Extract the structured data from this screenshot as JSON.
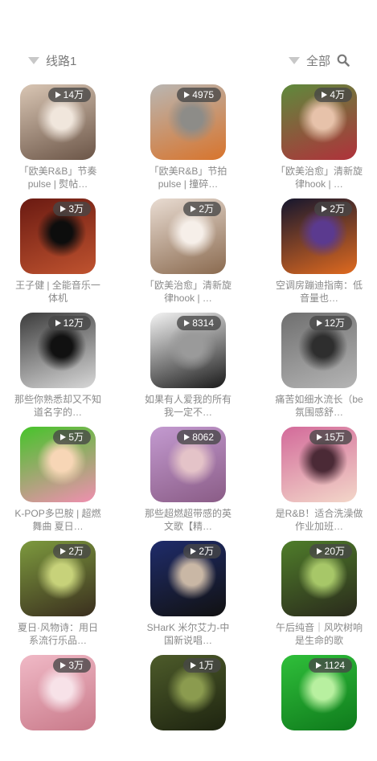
{
  "header": {
    "route_label": "线路1",
    "filter_label": "全部"
  },
  "playlists": [
    {
      "count": "14万",
      "title": "「欧美R&B」节奏pulse | 熨帖…",
      "thumb": "portrait-mirror",
      "colors": [
        "#d9c6b4",
        "#6b5547",
        "#f0e6dc"
      ]
    },
    {
      "count": "4975",
      "title": "「欧美R&B」节拍pulse | 撞碎…",
      "thumb": "orange-hair",
      "colors": [
        "#b9b6b2",
        "#d8742c",
        "#8d8c88"
      ]
    },
    {
      "count": "4万",
      "title": "「欧美治愈」清新旋律hook | …",
      "thumb": "red-jacket",
      "colors": [
        "#5e8a3c",
        "#b0313b",
        "#e7c2aa"
      ]
    },
    {
      "count": "3万",
      "title": "王子健 | 全能音乐一体机",
      "thumb": "red-planet",
      "colors": [
        "#6a1a12",
        "#c0532f",
        "#0d0d0d"
      ]
    },
    {
      "count": "2万",
      "title": "「欧美治愈」清新旋律hook | …",
      "thumb": "braids",
      "colors": [
        "#e9dcd2",
        "#8a6a4f",
        "#f6efe9"
      ]
    },
    {
      "count": "2万",
      "title": "空调房蹦迪指南：低音量也…",
      "thumb": "neon-boy",
      "colors": [
        "#15162e",
        "#e06a1f",
        "#5b3a8f"
      ]
    },
    {
      "count": "12万",
      "title": "那些你熟悉却又不知道名字的…",
      "thumb": "bw-book",
      "colors": [
        "#3c3c3c",
        "#d8d8d8",
        "#111111"
      ]
    },
    {
      "count": "8314",
      "title": "如果有人爱我的所有 我一定不…",
      "thumb": "manga",
      "colors": [
        "#f4f4f4",
        "#1a1a1a",
        "#9a9a9a"
      ]
    },
    {
      "count": "12万",
      "title": "痛苦如细水流长（be氛围感舒…",
      "thumb": "bw-pattern",
      "colors": [
        "#6f6f6f",
        "#b5b5b5",
        "#2e2e2e"
      ]
    },
    {
      "count": "5万",
      "title": "K-POP多巴胺 | 超燃舞曲 夏日…",
      "thumb": "anime-girl",
      "colors": [
        "#46c42a",
        "#f08fb0",
        "#f7d6b6"
      ]
    },
    {
      "count": "8062",
      "title": "那些超燃超带感的英文歌【精…",
      "thumb": "flower-girl",
      "colors": [
        "#c39ad0",
        "#8a5c86",
        "#e4c3c8"
      ]
    },
    {
      "count": "15万",
      "title": "是R&B！适合洗澡做作业加班…",
      "thumb": "pink-hair",
      "colors": [
        "#d36a9a",
        "#f3d7c9",
        "#4b2a36"
      ]
    },
    {
      "count": "2万",
      "title": "夏日·风物诗：用日系流行乐品…",
      "thumb": "window-green",
      "colors": [
        "#7d9a3e",
        "#3a2e1e",
        "#c7d27a"
      ]
    },
    {
      "count": "2万",
      "title": "SHarK 米尔艾力-中国新说唱…",
      "thumb": "jersey",
      "colors": [
        "#1f2c6b",
        "#111111",
        "#c9b7a5"
      ]
    },
    {
      "count": "20万",
      "title": "午后纯音｜风吹树响是生命的歌",
      "thumb": "window-forest",
      "colors": [
        "#4f7d2a",
        "#2a2a1c",
        "#a7c768"
      ]
    },
    {
      "count": "3万",
      "title": "",
      "thumb": "pink-bottom",
      "colors": [
        "#f0b9c6",
        "#c97a8a",
        "#f7e2e8"
      ]
    },
    {
      "count": "1万",
      "title": "",
      "thumb": "green-bottom",
      "colors": [
        "#4d5b2a",
        "#1e2410",
        "#8b9b4f"
      ]
    },
    {
      "count": "1124",
      "title": "",
      "thumb": "lime-bottom",
      "colors": [
        "#2fbf3a",
        "#0f7a1c",
        "#b8f0a0"
      ]
    }
  ]
}
